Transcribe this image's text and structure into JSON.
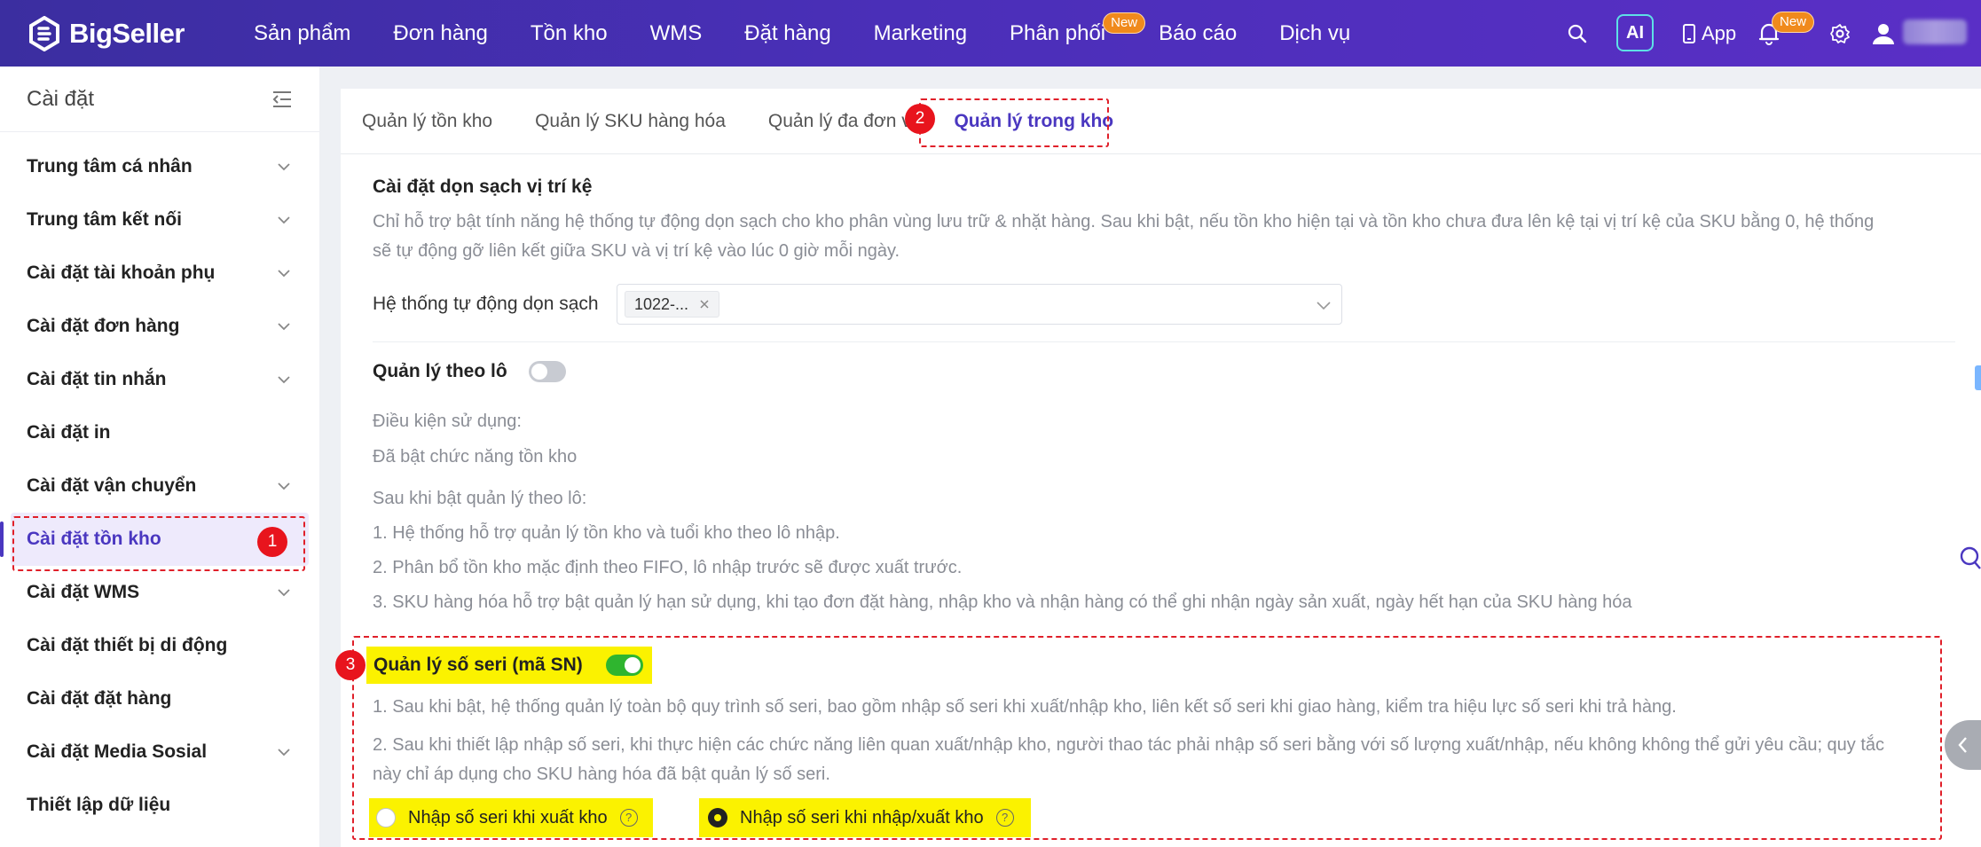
{
  "brand": {
    "name": "BigSeller"
  },
  "nav": {
    "items": [
      {
        "label": "Sản phẩm"
      },
      {
        "label": "Đơn hàng"
      },
      {
        "label": "Tồn kho"
      },
      {
        "label": "WMS"
      },
      {
        "label": "Đặt hàng"
      },
      {
        "label": "Marketing"
      },
      {
        "label": "Phân phối",
        "badge": "New"
      },
      {
        "label": "Báo cáo"
      },
      {
        "label": "Dịch vụ"
      }
    ]
  },
  "toolbar": {
    "ai_label": "AI",
    "app_label": "App",
    "notification_badge": "New"
  },
  "sidebar": {
    "title": "Cài đặt",
    "items": [
      {
        "label": "Trung tâm cá nhân",
        "expandable": true
      },
      {
        "label": "Trung tâm kết nối",
        "expandable": true
      },
      {
        "label": "Cài đặt tài khoản phụ",
        "expandable": true
      },
      {
        "label": "Cài đặt đơn hàng",
        "expandable": true
      },
      {
        "label": "Cài đặt tin nhắn",
        "expandable": true
      },
      {
        "label": "Cài đặt in",
        "expandable": false
      },
      {
        "label": "Cài đặt vận chuyển",
        "expandable": true
      },
      {
        "label": "Cài đặt tồn kho",
        "expandable": false,
        "active": true
      },
      {
        "label": "Cài đặt WMS",
        "expandable": true
      },
      {
        "label": "Cài đặt thiết bị di động",
        "expandable": false
      },
      {
        "label": "Cài đặt đặt hàng",
        "expandable": false
      },
      {
        "label": "Cài đặt Media Sosial",
        "expandable": true
      },
      {
        "label": "Thiết lập dữ liệu",
        "expandable": false
      }
    ]
  },
  "tabs": [
    {
      "label": "Quản lý tồn kho"
    },
    {
      "label": "Quản lý SKU hàng hóa"
    },
    {
      "label": "Quản lý đa đơn vị"
    },
    {
      "label": "Quản lý trong kho",
      "active": true
    }
  ],
  "annotations": {
    "m1": "1",
    "m2": "2",
    "m3": "3"
  },
  "shelf_cleanup": {
    "title": "Cài đặt dọn sạch vị trí kệ",
    "desc_line1": "Chỉ hỗ trợ bật tính năng hệ thống tự động dọn sạch cho kho phân vùng lưu trữ & nhặt hàng. Sau khi bật, nếu tồn kho hiện tại và tồn kho chưa đưa lên kệ tại vị trí kệ của SKU bằng 0, hệ thống",
    "desc_line2": "sẽ tự động gỡ liên kết giữa SKU và vị trí kệ vào lúc 0 giờ mỗi ngày.",
    "field_label": "Hệ thống tự động dọn sạch",
    "selected_tag": "1022-..."
  },
  "batch": {
    "title": "Quản lý theo lô",
    "enabled": false,
    "cond_label": "Điều kiện sử dụng:",
    "cond_value": "Đã bật chức năng tồn kho",
    "after_label": "Sau khi bật quản lý theo lô:",
    "points": [
      "1. Hệ thống hỗ trợ quản lý tồn kho và tuổi kho theo lô nhập.",
      "2. Phân bổ tồn kho mặc định theo FIFO, lô nhập trước sẽ được xuất trước.",
      "3. SKU hàng hóa hỗ trợ bật quản lý hạn sử dụng, khi tạo đơn đặt hàng, nhập kho và nhận hàng có thể ghi nhận ngày sản xuất, ngày hết hạn của SKU hàng hóa"
    ]
  },
  "serial": {
    "title": "Quản lý số seri (mã SN)",
    "enabled": true,
    "point1": "1. Sau khi bật, hệ thống quản lý toàn bộ quy trình số seri, bao gồm nhập số seri khi xuất/nhập kho, liên kết số seri khi giao hàng, kiểm tra hiệu lực số seri khi trả hàng.",
    "point2_line1": "2. Sau khi thiết lập nhập số seri, khi thực hiện các chức năng liên quan xuất/nhập kho, người thao tác phải nhập số seri bằng với số lượng xuất/nhập, nếu không không thể gửi yêu cầu; quy tắc",
    "point2_line2": "này chỉ áp dụng cho SKU hàng hóa đã bật quản lý số seri.",
    "option_export": "Nhập số seri khi xuất kho",
    "option_import_export": "Nhập số seri khi nhập/xuất kho",
    "selected": "import_export"
  },
  "colors": {
    "brand": "#4a37c0",
    "highlight": "#fbf200",
    "annotation": "#e0202a",
    "toggle_on": "#2fb52f"
  }
}
